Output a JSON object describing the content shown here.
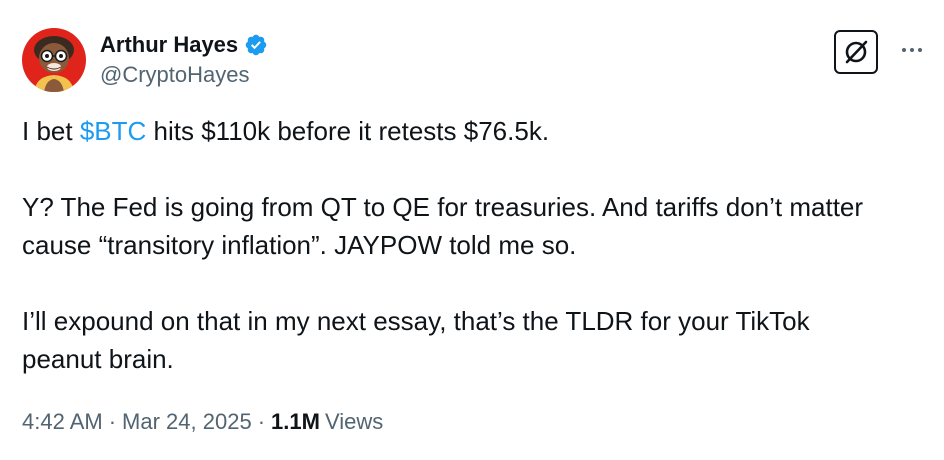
{
  "author": {
    "display_name": "Arthur Hayes",
    "handle": "@CryptoHayes",
    "verified": true,
    "verified_color": "#1d9bf0",
    "avatar": "cartoon-character-avatar-red-background"
  },
  "header_actions": {
    "grok_icon": "grok-slashed-circle-icon",
    "more_icon": "more-dots-icon"
  },
  "tweet": {
    "line1_before": "I bet ",
    "cashtag": "$BTC",
    "line1_after": " hits $110k before it retests $76.5k.",
    "line2": "Y? The Fed is going from QT to QE for treasuries. And tariffs don’t matter",
    "line3": "cause “transitory inflation”. JAYPOW told me so.",
    "line4": "I’ll expound on that in my next essay, that’s the TLDR for your TikTok",
    "line5": "peanut brain."
  },
  "meta": {
    "time": "4:42 AM",
    "separator": "·",
    "date": "Mar 24, 2025",
    "views_count": "1.1M",
    "views_label": "Views"
  },
  "colors": {
    "text": "#0f1419",
    "secondary": "#536471",
    "link": "#1d9bf0",
    "avatar_bg": "#e0241c"
  }
}
